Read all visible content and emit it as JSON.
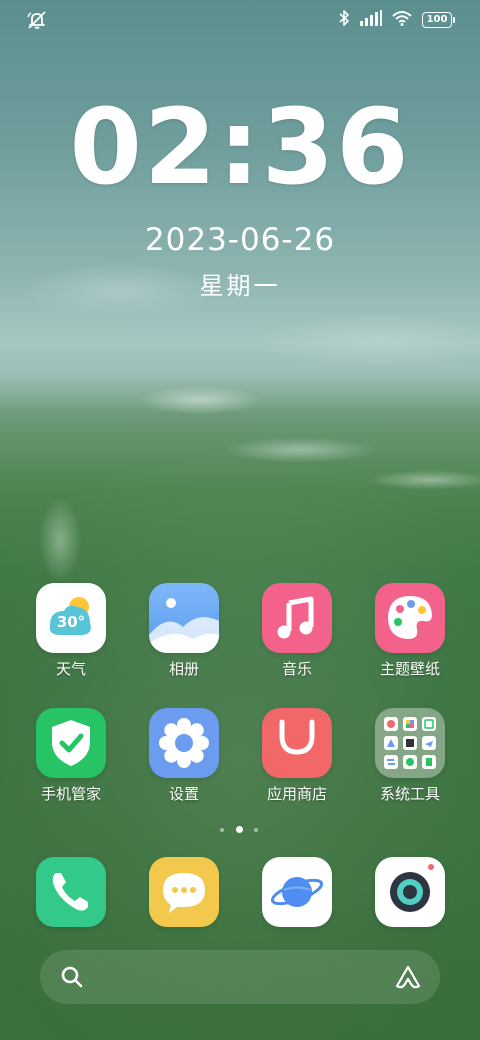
{
  "status_bar": {
    "left_icon": "notification-muted-icon",
    "icons": [
      "bluetooth-icon",
      "signal-icon",
      "wifi-icon",
      "battery-icon"
    ],
    "battery_level": "100"
  },
  "clock": {
    "time": "02:36"
  },
  "date": {
    "date": "2023-06-26",
    "weekday": "星期一"
  },
  "apps": [
    {
      "label": "天气",
      "icon": "weather-icon",
      "temperature": "30°"
    },
    {
      "label": "相册",
      "icon": "gallery-icon"
    },
    {
      "label": "音乐",
      "icon": "music-icon"
    },
    {
      "label": "主题壁纸",
      "icon": "theme-palette-icon"
    },
    {
      "label": "手机管家",
      "icon": "security-shield-icon"
    },
    {
      "label": "设置",
      "icon": "settings-gear-icon"
    },
    {
      "label": "应用商店",
      "icon": "app-store-bag-icon"
    },
    {
      "label": "系统工具",
      "icon": "system-tools-folder-icon"
    }
  ],
  "page_indicator": {
    "pages": 3,
    "current": 2
  },
  "dock": [
    {
      "icon": "phone-icon"
    },
    {
      "icon": "messages-icon"
    },
    {
      "icon": "browser-planet-icon"
    },
    {
      "icon": "camera-icon"
    }
  ],
  "search_bar": {
    "left_icon": "search-icon",
    "right_icon": "assistant-icon"
  },
  "colors": {
    "weather_bg": "#ffffff",
    "gallery": "#6aa6f5",
    "music": "#f2628a",
    "theme": "#f2628a",
    "security": "#27c466",
    "settings": "#6b9cf0",
    "store": "#f26868",
    "phone": "#32c98a",
    "messages": "#f2c94c",
    "browser": "#ffffff",
    "camera": "#ffffff"
  }
}
